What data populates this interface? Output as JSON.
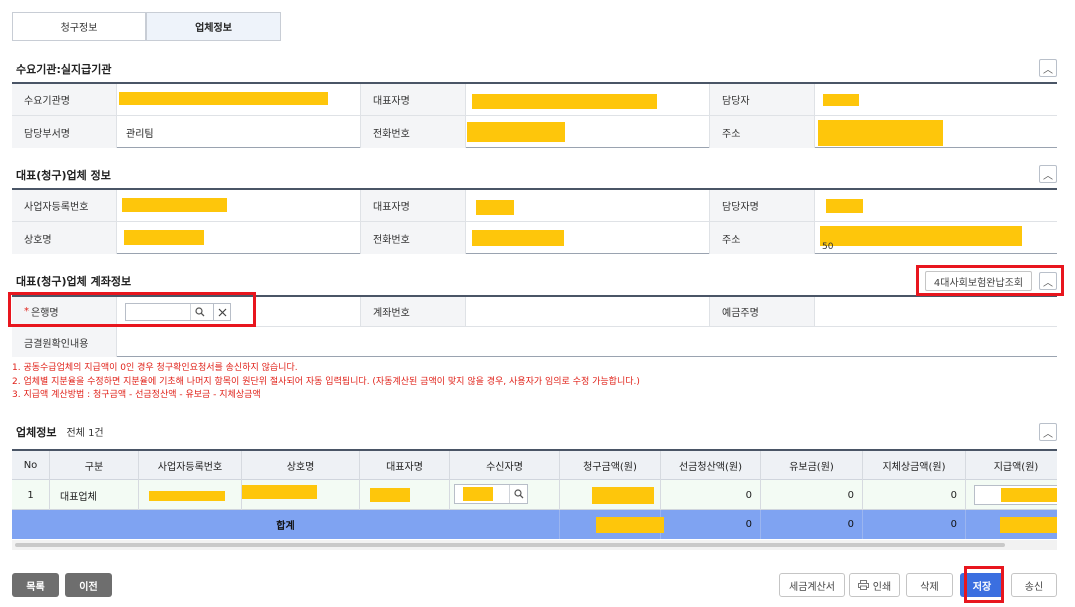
{
  "tabs": [
    "청구정보",
    "업체정보"
  ],
  "sections": {
    "demand_org": {
      "title": "수요기관:실지급기관",
      "labels": [
        "수요기관명",
        "대표자명",
        "담당자",
        "담당부서명",
        "전화번호",
        "주소"
      ],
      "dept_value": "관리팀"
    },
    "vendor_info": {
      "title": "대표(청구)업체 정보",
      "labels": [
        "사업자등록번호",
        "대표자명",
        "담당자명",
        "상호명",
        "전화번호",
        "주소"
      ],
      "address_suffix": "50"
    },
    "account": {
      "title": "대표(청구)업체 계좌정보",
      "inquiry_button": "4대사회보험완납조회",
      "required_mark": "*",
      "labels": [
        "은행명",
        "계좌번호",
        "예금주명",
        "금결원확인내용"
      ]
    }
  },
  "notes": [
    "1. 공동수급업체의 지급액이 0인 경우 청구확인요청서를 송신하지 않습니다.",
    "2. 업체별 지분율을 수정하면 지분율에 기초해 나머지 항목이 원단위 절사되어 자동 입력됩니다. (자동계산된 금액이 맞지 않을 경우, 사용자가 임의로 수정 가능합니다.)",
    "3. 지급액 계산방법 : 청구금액 - 선금정산액 - 유보금 - 지체상금액"
  ],
  "vendor_table": {
    "title": "업체정보",
    "count_text": "전체 1건",
    "columns": [
      "No",
      "구분",
      "사업자등록번호",
      "상호명",
      "대표자명",
      "수신자명",
      "청구금액(원)",
      "선금청산액(원)",
      "유보금(원)",
      "지체상금액(원)",
      "지급액(원)"
    ],
    "rows": [
      {
        "no": "1",
        "type": "대표업체",
        "advance": "0",
        "retention": "0",
        "delay": "0"
      }
    ],
    "total": {
      "label": "합계",
      "advance": "0",
      "retention": "0",
      "delay": "0"
    }
  },
  "buttons": {
    "list": "목록",
    "prev": "이전",
    "tax_invoice": "세금계산서",
    "print": "인쇄",
    "delete": "삭제",
    "save": "저장",
    "send": "송신"
  },
  "icons": {
    "collapse": "chevron-up-icon",
    "search": "search-icon",
    "clear": "close-icon",
    "print": "printer-icon"
  },
  "colors": {
    "redacted": "#fec60b",
    "highlight_box": "#e8161e",
    "total_row": "#7fa3f2",
    "save": "#3b6fe0",
    "notes": "#e0221a"
  }
}
